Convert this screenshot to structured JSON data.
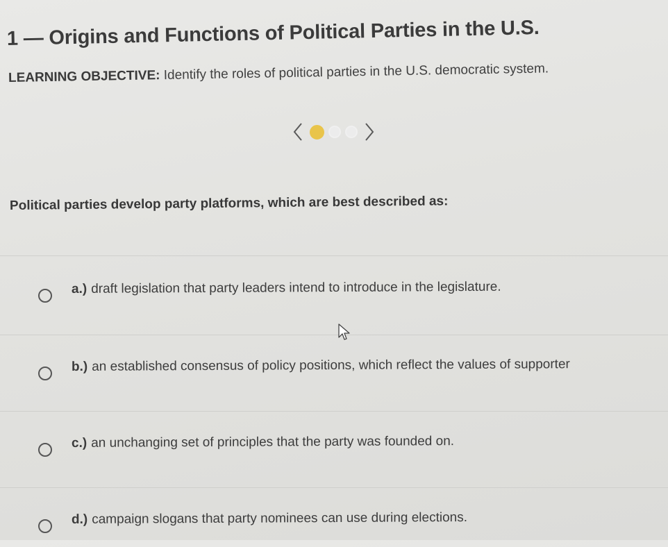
{
  "header": {
    "title": "1 — Origins and Functions of Political Parties in the U.S."
  },
  "objective": {
    "label": "LEARNING OBJECTIVE:",
    "text": "Identify the roles of political parties in the U.S. democratic system."
  },
  "pager": {
    "prev_icon": "chevron-left-icon",
    "next_icon": "chevron-right-icon",
    "total_dots": 3,
    "active_index": 0,
    "active_color": "#e9c44a"
  },
  "question": {
    "prompt": "Political parties develop party platforms, which are best described as:"
  },
  "options": [
    {
      "letter": "a.)",
      "text": "draft legislation that party leaders intend to introduce in the legislature."
    },
    {
      "letter": "b.)",
      "text": "an established consensus of policy positions, which reflect the values of supporter"
    },
    {
      "letter": "c.)",
      "text": "an unchanging set of principles that the party was founded on."
    },
    {
      "letter": "d.)",
      "text": "campaign slogans that party nominees can use during elections."
    }
  ],
  "cursor_icon": "mouse-pointer-icon"
}
